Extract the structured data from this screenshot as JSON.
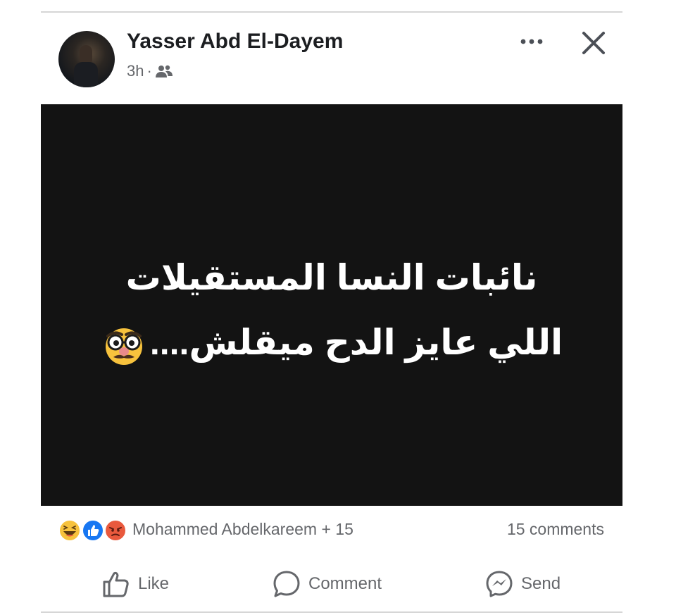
{
  "post": {
    "author": "Yasser Abd El-Dayem",
    "timestamp": "3h",
    "separator": "·",
    "audience_icon": "friends-icon",
    "image_text": {
      "line1": "نائبات النسا المستقيلات",
      "line2": "اللي عايز الدح ميقلش...."
    }
  },
  "header_actions": {
    "more_icon": "more-options-icon",
    "close_icon": "close-icon"
  },
  "reactions": {
    "icons": [
      "haha-icon",
      "like-icon",
      "angry-icon"
    ],
    "names": "Mohammed Abdelkareem + 15",
    "comments": "15 comments"
  },
  "actions": {
    "like_label": "Like",
    "comment_label": "Comment",
    "send_label": "Send"
  },
  "colors": {
    "text_primary": "#1c1e21",
    "text_secondary": "#65676b",
    "image_background": "#131313",
    "like_blue": "#1877f2",
    "angry_red": "#e9593d",
    "haha_yellow": "#f7c23d"
  }
}
